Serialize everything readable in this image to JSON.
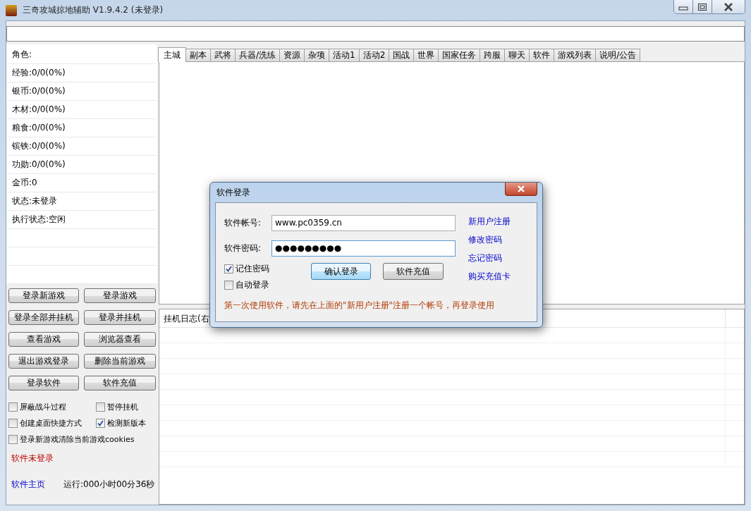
{
  "window": {
    "title": "三奇攻城掠地辅助 V1.9.4.2 (未登录)"
  },
  "info_rows": [
    "角色:",
    "经验:0/0(0%)",
    "银币:0/0(0%)",
    "木材:0/0(0%)",
    "粮食:0/0(0%)",
    "镔铁:0/0(0%)",
    "功勋:0/0(0%)",
    "金币:0",
    "状态:未登录",
    "执行状态:空闲"
  ],
  "actions": [
    "登录新游戏",
    "登录游戏",
    "登录全部并挂机",
    "登录并挂机",
    "查看游戏",
    "浏览器查看",
    "退出游戏登录",
    "删除当前游戏",
    "登录软件",
    "软件充值"
  ],
  "options": [
    {
      "label": "屏蔽战斗过程",
      "checked": false
    },
    {
      "label": "暂停挂机",
      "checked": false
    },
    {
      "label": "创建桌面快捷方式",
      "checked": false
    },
    {
      "label": "检测新版本",
      "checked": true
    },
    {
      "label": "登录新游戏清除当前游戏cookies",
      "checked": false
    }
  ],
  "login_status": "软件未登录",
  "homepage_link": "软件主页",
  "runtime": "运行:000小时00分36秒",
  "tabs": [
    {
      "label": "主城",
      "selected": true
    },
    {
      "label": "副本",
      "selected": false
    },
    {
      "label": "武将",
      "selected": false
    },
    {
      "label": "兵器/洗练",
      "selected": false
    },
    {
      "label": "资源",
      "selected": false
    },
    {
      "label": "杂项",
      "selected": false
    },
    {
      "label": "活动1",
      "selected": false
    },
    {
      "label": "活动2",
      "selected": false
    },
    {
      "label": "国战",
      "selected": false
    },
    {
      "label": "世界",
      "selected": false
    },
    {
      "label": "国家任务",
      "selected": false
    },
    {
      "label": "跨服",
      "selected": false
    },
    {
      "label": "聊天",
      "selected": false
    },
    {
      "label": "软件",
      "selected": false
    },
    {
      "label": "游戏列表",
      "selected": false
    },
    {
      "label": "说明/公告",
      "selected": false
    }
  ],
  "log": {
    "header": "挂机日志(右"
  },
  "dialog": {
    "title": "软件登录",
    "fields": [
      {
        "label": "软件帐号:",
        "value": "www.pc0359.cn"
      },
      {
        "label": "软件密码:",
        "value": "●●●●●●●●●"
      }
    ],
    "checkboxes": [
      {
        "label": "记住密码",
        "checked": true
      },
      {
        "label": "自动登录",
        "checked": false
      }
    ],
    "buttons": [
      "确认登录",
      "软件充值"
    ],
    "links": [
      "新用户注册",
      "修改密码",
      "忘记密码",
      "购买充值卡"
    ],
    "notice": "第一次使用软件，请先在上面的\"新用户注册\"注册一个帐号，再登录使用"
  }
}
